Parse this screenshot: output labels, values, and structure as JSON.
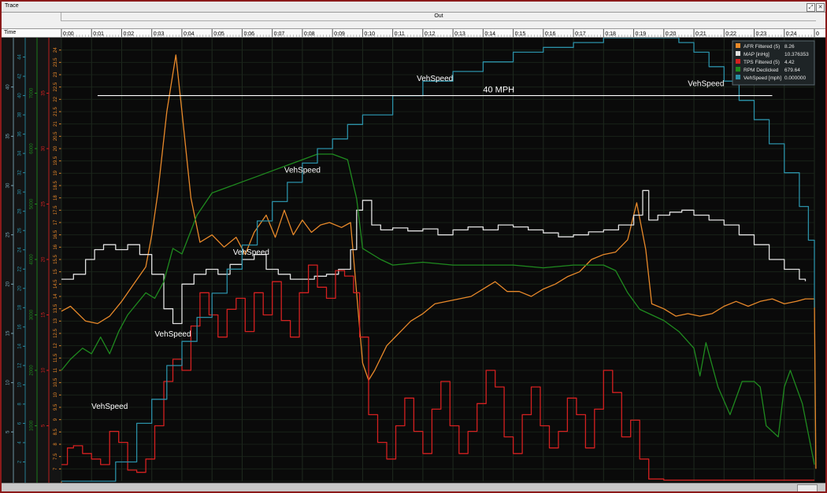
{
  "window": {
    "title": "Trace",
    "section": "Out",
    "restore_glyph": "⤢",
    "close_glyph": "✕"
  },
  "time_axis": {
    "label": "Time",
    "ticks": [
      "0:00",
      "0:01",
      "0:02",
      "0:03",
      "0:04",
      "0:05",
      "0:06",
      "0:07",
      "0:08",
      "0:09",
      "0:10",
      "0:11",
      "0:12",
      "0:13",
      "0:14",
      "0:15",
      "0:16",
      "0:17",
      "0:18",
      "0:19",
      "0:20",
      "0:21",
      "0:22",
      "0:23",
      "0:24",
      "0"
    ]
  },
  "annotation": {
    "text": "40 MPH"
  },
  "legend": {
    "entries": [
      {
        "name": "AFR Filtered (5)",
        "value": "8.26",
        "color": "#e8892a"
      },
      {
        "name": "MAP [inHg]",
        "value": "10.376353",
        "color": "#e0e0e0"
      },
      {
        "name": "TPS Filtered (5)",
        "value": "4.42",
        "color": "#d42020"
      },
      {
        "name": "RPM Declicked",
        "value": "679.64",
        "color": "#1f8a1f"
      },
      {
        "name": "VehSpeed [mph]",
        "value": "0.000000",
        "color": "#2a8fa6"
      }
    ]
  },
  "veh_labels": [
    {
      "text": "VehSpeed",
      "t": 1.6,
      "v": 7.5
    },
    {
      "text": "VehSpeed",
      "t": 3.7,
      "v": 15
    },
    {
      "text": "VehSpeed",
      "t": 6.3,
      "v": 23.5
    },
    {
      "text": "VehSpeed",
      "t": 8.0,
      "v": 32
    },
    {
      "text": "VehSpeed",
      "t": 12.4,
      "v": 41.5
    },
    {
      "text": "VehSpeed",
      "t": 21.4,
      "v": 41
    }
  ],
  "chart_data": {
    "type": "line",
    "x_unit": "seconds",
    "xlim": [
      0,
      25
    ],
    "axes": [
      {
        "id": "afr",
        "color": "#e8892a",
        "ylim": [
          6.5,
          24.5
        ],
        "ticks": [
          "6.5",
          "7",
          "7.5",
          "8",
          "8.5",
          "9",
          "9.5",
          "10",
          "10.5",
          "11",
          "11.5",
          "12",
          "12.5",
          "13",
          "13.5",
          "14",
          "14.5",
          "15",
          "15.5",
          "16",
          "16.5",
          "17",
          "17.5",
          "18",
          "18.5",
          "19",
          "19.5",
          "20",
          "20.5",
          "21",
          "21.5",
          "22",
          "22.5",
          "23",
          "23.5",
          "24"
        ]
      },
      {
        "id": "tps",
        "color": "#d42020",
        "ylim": [
          0,
          40
        ],
        "ticks": [
          "0",
          "5",
          "10",
          "15",
          "20",
          "25",
          "30",
          "35",
          "40"
        ]
      },
      {
        "id": "rpm",
        "color": "#1f8a1f",
        "ylim": [
          0,
          8000
        ],
        "ticks": [
          "1000",
          "2000",
          "3000",
          "4000",
          "5000",
          "6000",
          "7000",
          "8000"
        ]
      },
      {
        "id": "speed",
        "color": "#2a8fa6",
        "ylim": [
          0,
          46
        ],
        "ticks": [
          "2",
          "4",
          "6",
          "8",
          "10",
          "12",
          "14",
          "16",
          "18",
          "20",
          "22",
          "24",
          "26",
          "28",
          "30",
          "32",
          "34",
          "36",
          "38",
          "40",
          "42",
          "44"
        ]
      },
      {
        "id": "map",
        "color": "#7aa8b8",
        "ylim": [
          0,
          45
        ],
        "ticks": [
          "5",
          "10",
          "15",
          "20",
          "25",
          "30",
          "35",
          "40",
          "45"
        ]
      }
    ],
    "threshold_speed": 40,
    "series": [
      {
        "name": "AFR Filtered (5)",
        "axis": "afr",
        "color": "#e8892a",
        "step": false,
        "x": [
          0,
          0.3,
          0.8,
          1.2,
          1.6,
          2.0,
          2.4,
          2.8,
          3.0,
          3.2,
          3.5,
          3.8,
          4.0,
          4.3,
          4.6,
          5.0,
          5.4,
          5.8,
          6.1,
          6.4,
          6.8,
          7.1,
          7.4,
          7.7,
          8.0,
          8.3,
          8.6,
          8.9,
          9.3,
          9.6,
          10.0,
          10.2,
          10.4,
          10.8,
          11.2,
          11.6,
          12.0,
          12.4,
          12.8,
          13.2,
          13.6,
          14.0,
          14.4,
          14.8,
          15.2,
          15.6,
          16.0,
          16.4,
          16.8,
          17.2,
          17.6,
          18.0,
          18.4,
          18.8,
          19.1,
          19.4,
          19.6,
          20.0,
          20.4,
          20.8,
          21.2,
          21.6,
          22.0,
          22.4,
          22.8,
          23.2,
          23.6,
          24.0,
          24.4,
          24.7,
          25.0,
          25.05
        ],
        "y": [
          13.4,
          13.6,
          13.0,
          12.9,
          13.2,
          13.8,
          14.5,
          15.2,
          16.5,
          18.2,
          21.5,
          23.8,
          21.5,
          18.0,
          16.2,
          16.5,
          16.0,
          16.4,
          15.7,
          16.6,
          17.3,
          16.4,
          17.5,
          16.5,
          17.1,
          16.6,
          16.9,
          17.0,
          16.8,
          17.0,
          11.3,
          10.6,
          11.0,
          12.0,
          12.5,
          13.0,
          13.3,
          13.7,
          13.8,
          13.9,
          14.0,
          14.3,
          14.6,
          14.2,
          14.2,
          14.0,
          14.3,
          14.5,
          14.8,
          15.0,
          15.5,
          15.7,
          15.8,
          16.3,
          17.8,
          15.9,
          13.7,
          13.5,
          13.2,
          13.3,
          13.2,
          13.3,
          13.6,
          13.8,
          13.6,
          13.8,
          13.9,
          13.7,
          13.8,
          13.9,
          13.9,
          7.0
        ]
      },
      {
        "name": "MAP [inHg]",
        "axis": "map",
        "color": "#e0e0e0",
        "step": true,
        "x": [
          0,
          0.4,
          0.8,
          1.1,
          1.4,
          1.8,
          2.2,
          2.6,
          3.0,
          3.4,
          3.7,
          4.0,
          4.4,
          4.8,
          5.2,
          5.6,
          6.0,
          6.4,
          6.8,
          7.2,
          7.6,
          8.0,
          8.4,
          8.8,
          9.2,
          9.6,
          9.8,
          10.0,
          10.3,
          10.6,
          11.0,
          11.5,
          12.0,
          12.5,
          13.0,
          13.5,
          14.0,
          14.5,
          15.0,
          15.5,
          16.0,
          16.5,
          17.0,
          17.5,
          18.0,
          18.5,
          19.0,
          19.3,
          19.5,
          19.8,
          20.2,
          20.6,
          21.0,
          21.5,
          22.0,
          22.5,
          23.0,
          23.5,
          24.0,
          24.5,
          24.7
        ],
        "y": [
          20.5,
          21.0,
          22.5,
          23.5,
          24.0,
          23.5,
          24.0,
          23.0,
          21.0,
          17.5,
          16.0,
          20.0,
          21.0,
          21.5,
          21.0,
          22.0,
          22.5,
          23.0,
          21.5,
          21.0,
          20.5,
          20.5,
          20.8,
          21.0,
          21.5,
          23.5,
          27.5,
          28.5,
          26.0,
          25.5,
          25.7,
          25.4,
          25.6,
          25.0,
          25.5,
          25.8,
          25.5,
          26.0,
          25.8,
          25.5,
          25.2,
          24.8,
          25.0,
          25.3,
          25.5,
          26.0,
          27.0,
          29.5,
          26.5,
          27.0,
          27.3,
          27.5,
          27.0,
          26.5,
          26.0,
          25.0,
          24.0,
          22.5,
          21.5,
          20.5,
          20.3
        ]
      },
      {
        "name": "TPS Filtered (5)",
        "axis": "tps",
        "color": "#d42020",
        "step": true,
        "x": [
          0,
          0.2,
          0.4,
          0.7,
          1.0,
          1.3,
          1.6,
          1.9,
          2.2,
          2.5,
          2.8,
          3.1,
          3.4,
          3.7,
          4.0,
          4.3,
          4.6,
          4.9,
          5.2,
          5.5,
          5.8,
          6.1,
          6.4,
          6.7,
          7.0,
          7.3,
          7.6,
          7.9,
          8.2,
          8.5,
          8.8,
          9.1,
          9.4,
          9.7,
          9.9,
          10.2,
          10.5,
          10.8,
          11.1,
          11.4,
          11.7,
          12.0,
          12.3,
          12.6,
          12.9,
          13.2,
          13.5,
          13.8,
          14.1,
          14.4,
          14.7,
          15.0,
          15.3,
          15.6,
          15.9,
          16.2,
          16.5,
          16.8,
          17.1,
          17.4,
          17.7,
          18.0,
          18.3,
          18.6,
          18.9,
          19.2,
          19.5,
          20.0,
          22.0,
          24.0,
          25.0
        ],
        "y": [
          1.5,
          3.0,
          3.2,
          2.5,
          2.0,
          1.5,
          4.5,
          3.5,
          1.0,
          0.8,
          2.0,
          5.0,
          9.0,
          11.0,
          10.0,
          14.0,
          17.0,
          15.0,
          13.0,
          15.5,
          16.5,
          13.5,
          17.0,
          15.0,
          18.0,
          14.5,
          13.0,
          17.0,
          19.5,
          17.5,
          16.5,
          19.0,
          18.5,
          17.0,
          13.0,
          6.0,
          3.5,
          2.0,
          5.0,
          7.5,
          4.5,
          2.5,
          6.5,
          9.0,
          5.0,
          2.5,
          4.5,
          7.0,
          10.0,
          8.5,
          4.0,
          2.5,
          6.0,
          8.5,
          5.0,
          3.0,
          4.5,
          7.5,
          6.0,
          3.0,
          6.5,
          10.0,
          8.0,
          4.0,
          5.5,
          2.0,
          0.2,
          0.1,
          0.1,
          0.1,
          0.1
        ]
      },
      {
        "name": "RPM Declicked",
        "axis": "rpm",
        "color": "#1f8a1f",
        "step": false,
        "x": [
          0,
          0.3,
          0.7,
          1.0,
          1.3,
          1.6,
          1.9,
          2.2,
          2.5,
          2.8,
          3.1,
          3.4,
          3.7,
          4.0,
          4.5,
          5.0,
          5.5,
          6.0,
          6.5,
          7.0,
          7.5,
          8.0,
          8.5,
          9.0,
          9.5,
          9.8,
          10.0,
          10.3,
          10.6,
          11.0,
          12.0,
          13.0,
          14.0,
          15.0,
          16.0,
          17.0,
          18.0,
          18.4,
          18.8,
          19.2,
          19.6,
          20.0,
          20.5,
          21.0,
          21.2,
          21.4,
          21.8,
          22.2,
          22.6,
          23.0,
          23.2,
          23.4,
          23.8,
          24.0,
          24.2,
          24.6,
          25.0
        ],
        "y": [
          2000,
          2200,
          2400,
          2300,
          2600,
          2300,
          2700,
          3000,
          3200,
          3400,
          3300,
          3600,
          4200,
          4100,
          4800,
          5200,
          5300,
          5400,
          5500,
          5600,
          5700,
          5800,
          5900,
          5900,
          5800,
          5100,
          4200,
          4100,
          4000,
          3900,
          3950,
          3900,
          3900,
          3900,
          3850,
          3900,
          3900,
          3800,
          3400,
          3100,
          3000,
          2900,
          2700,
          2400,
          1900,
          2500,
          1700,
          1200,
          1800,
          1800,
          1700,
          1000,
          800,
          1700,
          2000,
          1400,
          300
        ]
      },
      {
        "name": "VehSpeed [mph]",
        "axis": "speed",
        "color": "#2a8fa6",
        "step": true,
        "x": [
          0,
          1.7,
          1.8,
          2.5,
          3.0,
          3.5,
          4.0,
          4.5,
          5.0,
          5.5,
          6.0,
          6.5,
          7.0,
          7.5,
          8.0,
          8.5,
          9.0,
          9.5,
          10.0,
          11.0,
          12.0,
          13.0,
          14.0,
          15.0,
          16.0,
          17.0,
          18.0,
          19.0,
          20.0,
          20.5,
          21.0,
          21.5,
          22.0,
          22.5,
          23.0,
          23.5,
          24.0,
          24.5,
          24.8,
          25.0
        ],
        "y": [
          0,
          0,
          2,
          6,
          8.5,
          12,
          14.5,
          17,
          19.5,
          22,
          24.5,
          27,
          29,
          31,
          33,
          34.5,
          35.5,
          37,
          38,
          40,
          41.5,
          42.5,
          43.5,
          44.5,
          45,
          45.5,
          46,
          46,
          46,
          45.5,
          44.5,
          43,
          41.5,
          39.5,
          37.5,
          35,
          32,
          28.5,
          25,
          18
        ]
      }
    ]
  }
}
